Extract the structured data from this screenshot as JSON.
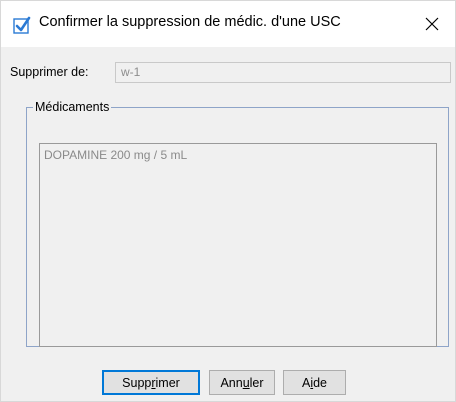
{
  "window": {
    "title": "Confirmer la suppression de médic. d'une USC",
    "close_icon": "close-icon",
    "title_icon": "checkbox-checked-icon"
  },
  "form": {
    "delete_from_label": "Supprimer de:",
    "delete_from_value": "w-1"
  },
  "medications": {
    "group_label": "Médicaments",
    "items": [
      "DOPAMINE 200 mg / 5 mL"
    ]
  },
  "buttons": {
    "delete": {
      "pre": "Supp",
      "mnemonic": "r",
      "post": "imer"
    },
    "cancel": {
      "pre": "Ann",
      "mnemonic": "u",
      "post": "ler"
    },
    "help": {
      "pre": "A",
      "mnemonic": "i",
      "post": "de"
    }
  },
  "colors": {
    "accent": "#0078d7",
    "group_border": "#8ea4c8",
    "dialog_bg": "#f0f0f0"
  }
}
